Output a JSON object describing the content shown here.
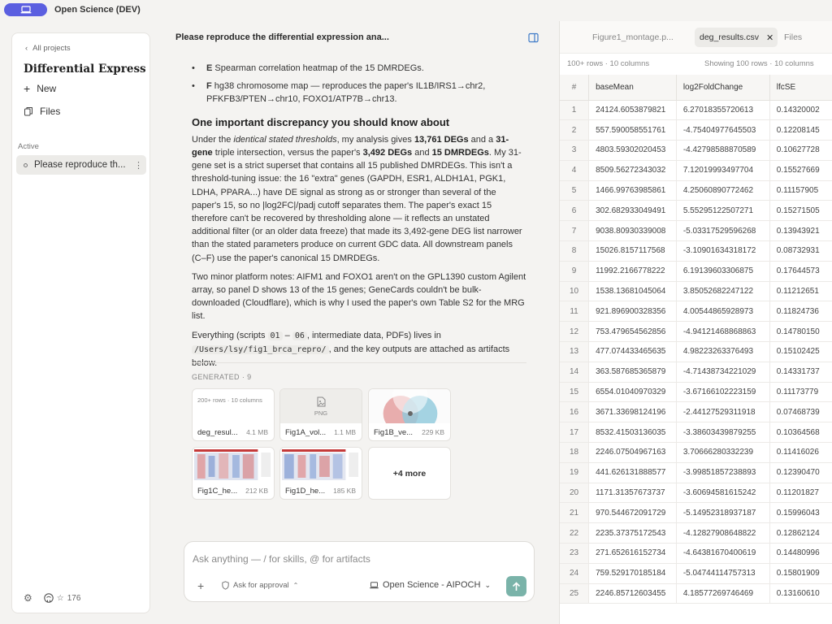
{
  "app": {
    "title": "Open Science (DEV)"
  },
  "sidebar": {
    "back_label": "All projects",
    "project_title": "Differential Express...",
    "new_label": "New",
    "files_label": "Files",
    "section_label": "Active",
    "active_chat": "Please reproduce th...",
    "stars": "176"
  },
  "chat": {
    "header": "Please reproduce the differential expression ana...",
    "bullets": [
      {
        "letter": "E",
        "text": "Spearman correlation heatmap of the 15 DMRDEGs."
      },
      {
        "letter": "F",
        "text": "hg38 chromosome map — reproduces the paper's IL1B/IRS1→chr2, PFKFB3/PTEN→chr10, FOXO1/ATP7B→chr13."
      }
    ],
    "heading": "One important discrepancy you should know about",
    "p1": {
      "a": "Under the ",
      "b": "identical stated thresholds",
      "c": ", my analysis gives ",
      "d": "13,761 DEGs",
      "e": " and a ",
      "f": "31-gene",
      "g": " triple intersection, versus the paper's ",
      "h": "3,492 DEGs",
      "i": " and ",
      "j": "15 DMRDEGs",
      "k": ". My 31-gene set is a strict superset that contains all 15 published DMRDEGs. This isn't a threshold-tuning issue: the 16 \"extra\" genes (GAPDH, ESR1, ALDH1A1, PGK1, LDHA, PPARA...) have DE signal as strong as or stronger than several of the paper's 15, so no |log2FC|/padj cutoff separates them. The paper's exact 15 therefore can't be recovered by thresholding alone — it reflects an unstated additional filter (or an older data freeze) that made its 3,492-gene DEG list narrower than the stated parameters produce on current GDC data. All downstream panels (C–F) use the paper's canonical 15 DMRDEGs."
    },
    "p2": "Two minor platform notes: AIFM1 and FOXO1 aren't on the GPL1390 custom Agilent array, so panel D shows 13 of the 15 genes; GeneCards couldn't be bulk-downloaded (Cloudflare), which is why I used the paper's own Table S2 for the MRG list.",
    "p3": {
      "a": "Everything (scripts ",
      "code1": "01",
      "dash": " – ",
      "code2": "06",
      "b": ", intermediate data, PDFs) lives in ",
      "code3": "/Users/lsy/fig1_brca_repro/",
      "c": ", and the key outputs are attached as artifacts below."
    },
    "generated_label": "GENERATED · 9",
    "artifacts": [
      {
        "name": "deg_resul...",
        "size": "4.1 MB",
        "preview": "200+ rows · 10 columns"
      },
      {
        "name": "Fig1A_vol...",
        "size": "1.1 MB",
        "preview": "PNG"
      },
      {
        "name": "Fig1B_ve...",
        "size": "229 KB"
      },
      {
        "name": "Fig1C_he...",
        "size": "212 KB"
      },
      {
        "name": "Fig1D_he...",
        "size": "185 KB"
      }
    ],
    "more_label": "+4 more"
  },
  "composer": {
    "placeholder": "Ask anything — / for skills, @ for artifacts",
    "approval_label": "Ask for approval",
    "model_label": "Open Science - AIPOCH"
  },
  "files_pane": {
    "tabs": {
      "inactive": "Figure1_montage.p...",
      "active": "deg_results.csv",
      "files": "Files"
    },
    "meta_left": "100+ rows · 10 columns",
    "meta_right": "Showing 100 rows · 10 columns",
    "columns": [
      "#",
      "baseMean",
      "log2FoldChange",
      "lfcSE"
    ],
    "rows": [
      [
        "1",
        "24124.6053879821",
        "6.27018355720613",
        "0.14320002"
      ],
      [
        "2",
        "557.590058551761",
        "-4.75404977645503",
        "0.12208145"
      ],
      [
        "3",
        "4803.59302020453",
        "-4.42798588870589",
        "0.10627728"
      ],
      [
        "4",
        "8509.56272343032",
        "7.12019993497704",
        "0.15527669"
      ],
      [
        "5",
        "1466.99763985861",
        "4.25060890772462",
        "0.11157905"
      ],
      [
        "6",
        "302.682933049491",
        "5.55295122507271",
        "0.15271505"
      ],
      [
        "7",
        "9038.80930339008",
        "-5.03317529596268",
        "0.13943921"
      ],
      [
        "8",
        "15026.8157117568",
        "-3.10901634318172",
        "0.08732931"
      ],
      [
        "9",
        "11992.2166778222",
        "6.19139603306875",
        "0.17644573"
      ],
      [
        "10",
        "1538.13681045064",
        "3.85052682247122",
        "0.11212651"
      ],
      [
        "11",
        "921.896900328356",
        "4.00544865928973",
        "0.11824736"
      ],
      [
        "12",
        "753.479654562856",
        "-4.94121468868863",
        "0.14780150"
      ],
      [
        "13",
        "477.074433465635",
        "4.98223263376493",
        "0.15102425"
      ],
      [
        "14",
        "363.587685365879",
        "-4.71438734221029",
        "0.14331737"
      ],
      [
        "15",
        "6554.01040970329",
        "-3.67166102223159",
        "0.11173779"
      ],
      [
        "16",
        "3671.33698124196",
        "-2.44127529311918",
        "0.07468739"
      ],
      [
        "17",
        "8532.41503136035",
        "-3.38603439879255",
        "0.10364568"
      ],
      [
        "18",
        "2246.07504967163",
        "3.70666280332239",
        "0.11416026"
      ],
      [
        "19",
        "441.626131888577",
        "-3.99851857238893",
        "0.12390470"
      ],
      [
        "20",
        "1171.31357673737",
        "-3.60694581615242",
        "0.11201827"
      ],
      [
        "21",
        "970.544672091729",
        "-5.14952318937187",
        "0.15996043"
      ],
      [
        "22",
        "2235.37375172543",
        "-4.12827908648822",
        "0.12862124"
      ],
      [
        "23",
        "271.652616152734",
        "-4.64381670400619",
        "0.14480996"
      ],
      [
        "24",
        "759.529170185184",
        "-5.04744114757313",
        "0.15801909"
      ],
      [
        "25",
        "2246.85712603455",
        "4.18577269746469",
        "0.13160610"
      ]
    ]
  }
}
